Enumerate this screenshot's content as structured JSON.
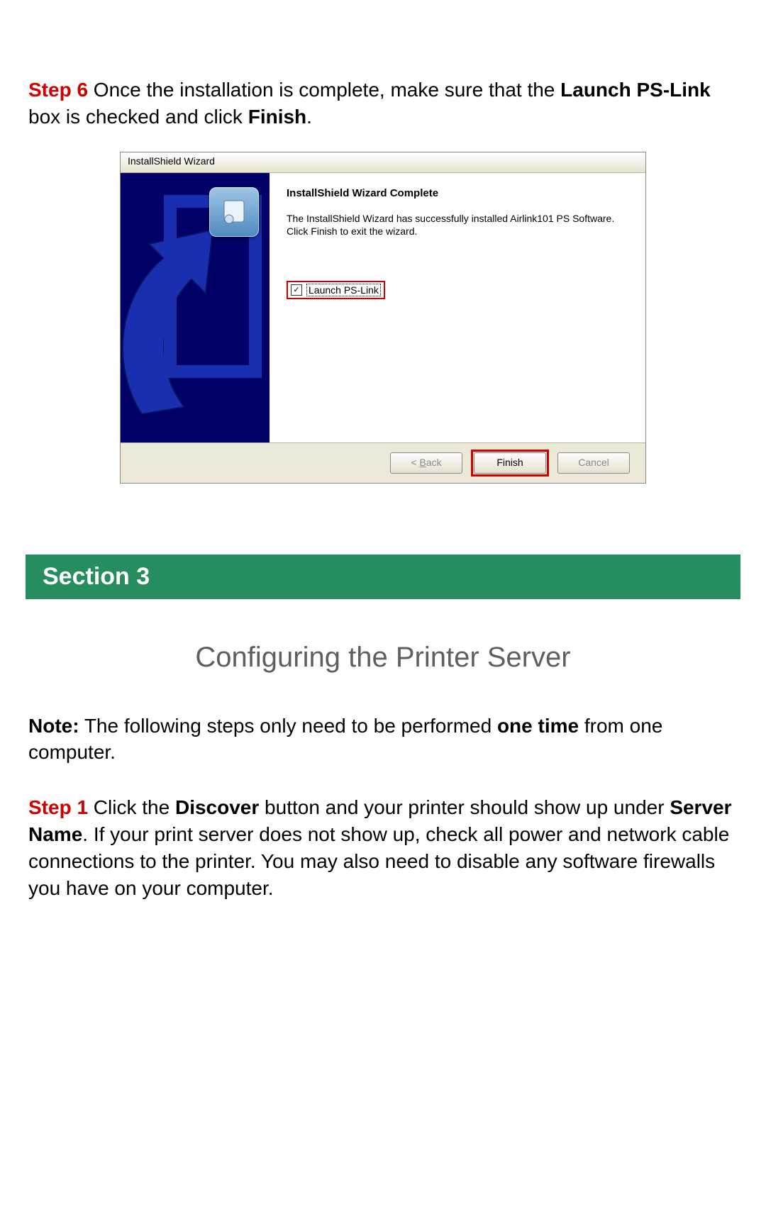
{
  "step6": {
    "label": "Step 6",
    "text_before_bold1": " Once the installation is complete, make sure that the ",
    "bold1": "Launch PS-Link",
    "text_mid": " box is checked and click ",
    "bold2": "Finish",
    "text_after": "."
  },
  "wizard": {
    "titlebar": "InstallShield Wizard",
    "heading": "InstallShield Wizard Complete",
    "body": "The InstallShield Wizard has successfully installed Airlink101 PS Software.  Click Finish to exit the wizard.",
    "checkbox_label": "Launch PS-Link",
    "btn_back_prefix": "< ",
    "btn_back_access": "B",
    "btn_back_suffix": "ack",
    "btn_finish": "Finish",
    "btn_cancel": "Cancel"
  },
  "section": {
    "bar": "Section 3",
    "title": "Configuring the Printer Server"
  },
  "note": {
    "label": "Note:",
    "t1": " The following steps only need to be performed ",
    "bold": "one time",
    "t2": " from one computer."
  },
  "step1": {
    "label": "Step 1",
    "t1": " Click the ",
    "b1": "Discover",
    "t2": " button and your printer should show up under ",
    "b2": "Server Name",
    "t3": ".  If your print server does not show up, check all power and network cable connections to the printer.  You may also need to disable any software firewalls you have on your computer."
  }
}
